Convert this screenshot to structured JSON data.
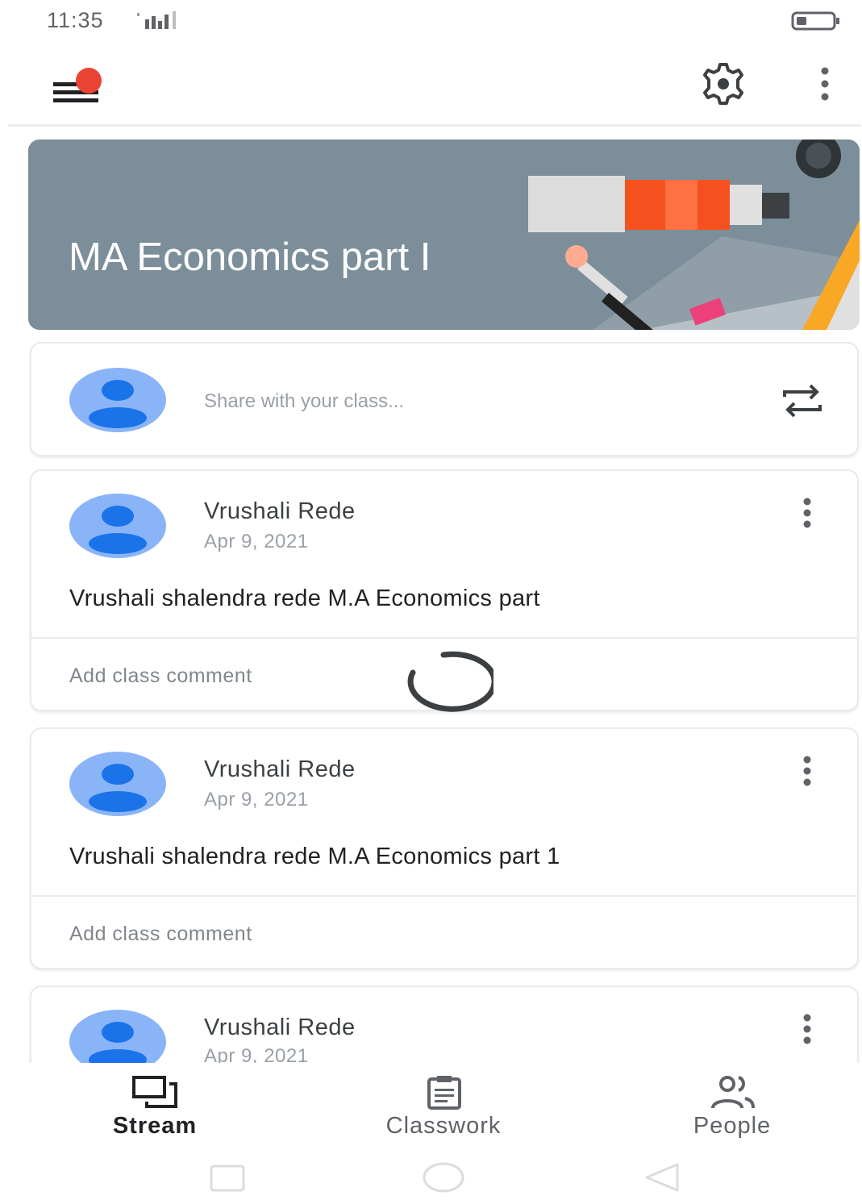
{
  "status_bar": {
    "time": "11:35",
    "icons": [
      "signal-icon",
      "battery-icon"
    ]
  },
  "app_bar": {
    "icons": [
      "menu-icon",
      "settings-icon",
      "more-vert-icon"
    ],
    "notification_color": "#ea4335"
  },
  "banner": {
    "title": "MA Economics part I",
    "background_color": "#7b8e99",
    "theme": "paint-tubes-illustration"
  },
  "share": {
    "placeholder": "Share with your class...",
    "icon": "repost-icon"
  },
  "posts": [
    {
      "author": "Vrushali Rede",
      "date": "Apr 9, 2021",
      "body": "Vrushali shalendra rede M.A Economics part",
      "comment_placeholder": "Add class comment"
    },
    {
      "author": "Vrushali Rede",
      "date": "Apr 9, 2021",
      "body": "Vrushali shalendra rede M.A Economics part 1",
      "comment_placeholder": "Add class comment"
    },
    {
      "author": "Vrushali Rede",
      "date": "Apr 9, 2021"
    }
  ],
  "bottom_nav": {
    "items": [
      {
        "label": "Stream",
        "icon": "stream-icon",
        "active": true
      },
      {
        "label": "Classwork",
        "icon": "classwork-icon",
        "active": false
      },
      {
        "label": "People",
        "icon": "people-icon",
        "active": false
      }
    ]
  },
  "system_nav": {
    "icons": [
      "recents-icon",
      "home-icon",
      "back-icon"
    ]
  },
  "colors": {
    "avatar_bg": "#8ab4f8",
    "avatar_fg": "#1a73e8",
    "accent_orange": "#f4511e"
  }
}
